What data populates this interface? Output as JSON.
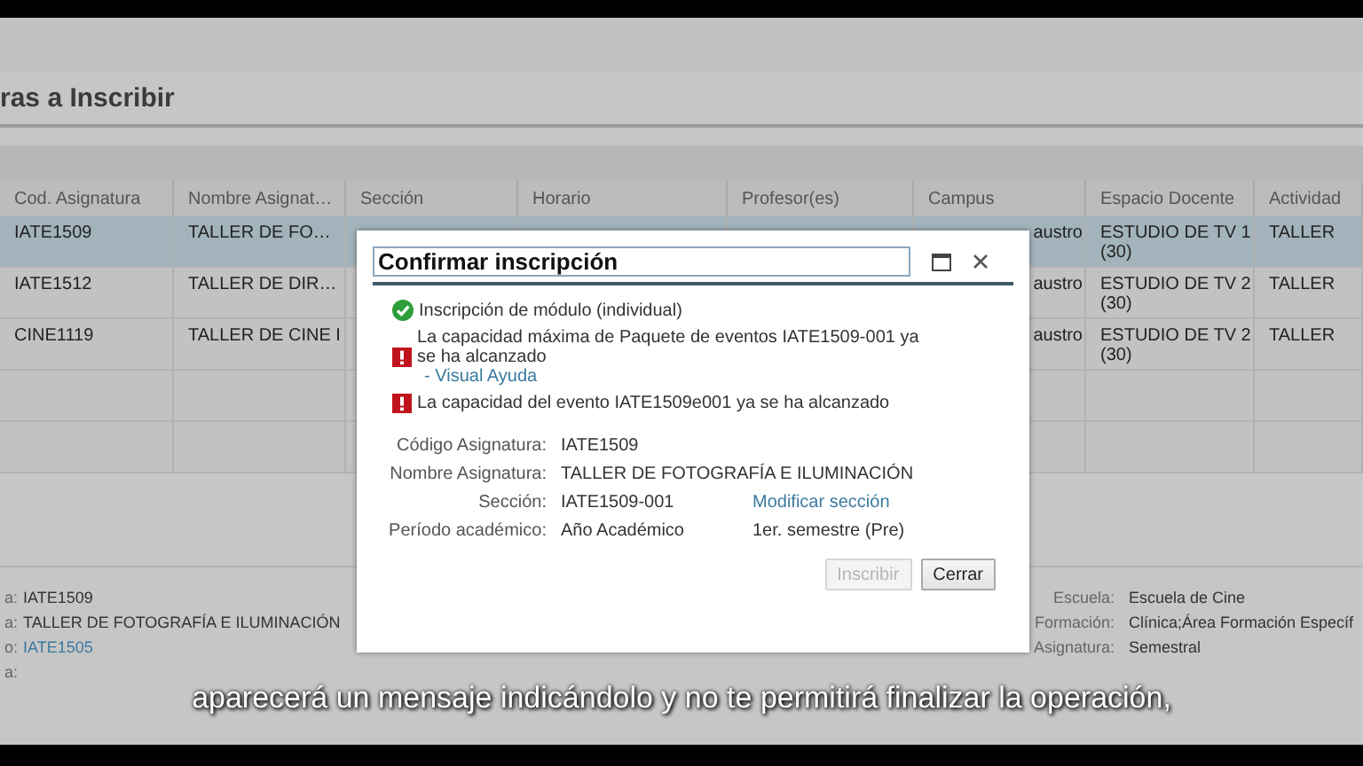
{
  "page": {
    "title": "ras a Inscribir"
  },
  "table": {
    "columns": [
      "Cod. Asignatura",
      "Nombre Asignat…",
      "Sección",
      "Horario",
      "Profesor(es)",
      "Campus",
      "Espacio Docente",
      "Actividad"
    ],
    "rows": [
      {
        "selected": true,
        "code": "IATE1509",
        "name": "TALLER DE FO…",
        "campus": "austro",
        "space": "ESTUDIO DE TV 1\n(30)",
        "activity": "TALLER"
      },
      {
        "selected": false,
        "code": "IATE1512",
        "name": "TALLER DE DIR…",
        "campus": "austro",
        "space": "ESTUDIO DE TV 2\n(30)",
        "activity": "TALLER"
      },
      {
        "selected": false,
        "code": "CINE1119",
        "name": "TALLER DE CINE I",
        "campus": "austro",
        "space": "ESTUDIO DE TV 2\n(30)",
        "activity": "TALLER"
      }
    ]
  },
  "details": {
    "left": [
      {
        "label": "a:",
        "value": "IATE1509",
        "kind": "text"
      },
      {
        "label": "a:",
        "value": "TALLER DE FOTOGRAFÍA E ILUMINACIÓN",
        "kind": "text"
      },
      {
        "label": "o:",
        "value": "IATE1505",
        "kind": "link"
      },
      {
        "label": "a:"
      }
    ],
    "right": [
      {
        "label": "Escuela:",
        "value": "Escuela de Cine"
      },
      {
        "label": "Formación:",
        "value": "Clínica;Área Formación Específ"
      },
      {
        "label": "Asignatura:",
        "value": "Semestral"
      }
    ]
  },
  "dialog": {
    "title": "Confirmar inscripción",
    "messages": [
      {
        "kind": "success",
        "text": "Inscripción de módulo (individual)"
      },
      {
        "kind": "error",
        "text": "La capacidad máxima de Paquete de eventos IATE1509-001 ya se ha alcanzado",
        "link": "- Visual Ayuda"
      },
      {
        "kind": "error",
        "text": "La capacidad del evento IATE1509e001 ya se ha alcanzado"
      }
    ],
    "fields": [
      {
        "label": "Código Asignatura:",
        "value": "IATE1509"
      },
      {
        "label": "Nombre Asignatura:",
        "value": "TALLER DE FOTOGRAFÍA E ILUMINACIÓN"
      },
      {
        "label": "Sección:",
        "value": "IATE1509-001",
        "link": "Modificar sección"
      },
      {
        "label": "Período académico:",
        "value": "Año Académico",
        "extra": "1er. semestre (Pre)"
      }
    ],
    "buttons": [
      {
        "label": "Inscribir",
        "disabled": true
      },
      {
        "label": "Cerrar",
        "disabled": false
      }
    ]
  },
  "subtitle": "aparecerá un mensaje indicándolo y no te permitirá finalizar la operación,"
}
